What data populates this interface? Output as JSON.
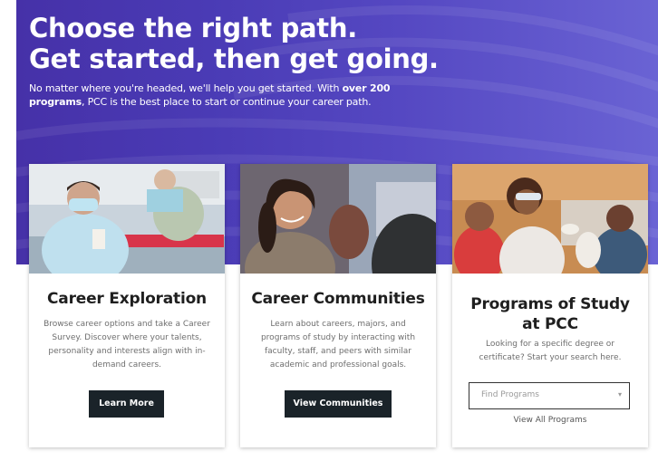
{
  "hero": {
    "title_line1": "Choose the right path.",
    "title_line2": "Get started, then get going.",
    "subtitle_pre": "No matter where you're headed, we'll help you get started. With ",
    "subtitle_bold": "over 200 programs",
    "subtitle_post": ", PCC is the best place to start or continue your career path.",
    "background_color": "#4a3bb5"
  },
  "cards": [
    {
      "title": "Career Exploration",
      "description": "Browse career options and take a Career Survey. Discover where your talents, personality and interests align with in-demand careers.",
      "button_label": "Learn More"
    },
    {
      "title": "Career Communities",
      "description": "Learn about careers, majors, and programs of study by interacting with faculty, staff, and peers with similar academic and professional goals.",
      "button_label": "View Communities"
    },
    {
      "title_line1": "Programs of Study",
      "title_line2": "at PCC",
      "description": "Looking for a specific degree or certificate? Start your search here.",
      "select_placeholder": "Find Programs",
      "link_label": "View All Programs"
    }
  ],
  "colors": {
    "button": "#1a2329",
    "title_text": "#1f1f1f"
  },
  "icons": {
    "dropdown": "chevron-down-icon"
  }
}
